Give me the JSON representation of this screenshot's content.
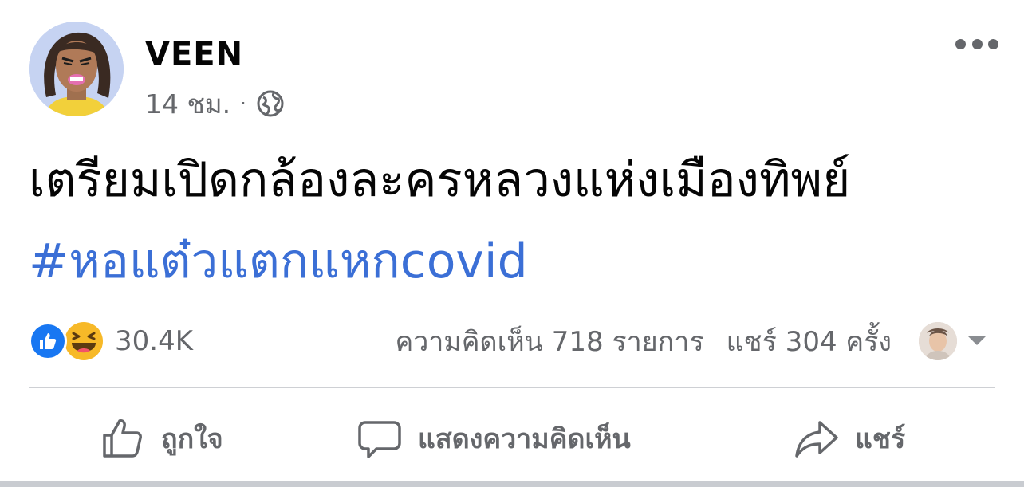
{
  "author": {
    "name": "VEEN",
    "avatar_icon": "cartoon-face-avatar"
  },
  "meta": {
    "time": "14 ชม.",
    "separator": "·",
    "privacy_icon": "globe-icon"
  },
  "post": {
    "text": "เตรียมเปิดกล้องละครหลวงแห่งเมืองทิพย์",
    "hashtag": "#หอแต๋วแตกแหกcovid"
  },
  "reactions": {
    "types": [
      "like",
      "haha"
    ],
    "count": "30.4K"
  },
  "stats": {
    "comments": "ความคิดเห็น 718 รายการ",
    "shares": "แชร์ 304 ครั้ง"
  },
  "actions": {
    "like_label": "ถูกใจ",
    "comment_label": "แสดงความคิดเห็น",
    "share_label": "แชร์"
  },
  "colors": {
    "hashtag": "#3b6fd6",
    "like_blue": "#1877f2",
    "haha_yellow": "#f7b928",
    "muted_text": "#65676b"
  }
}
